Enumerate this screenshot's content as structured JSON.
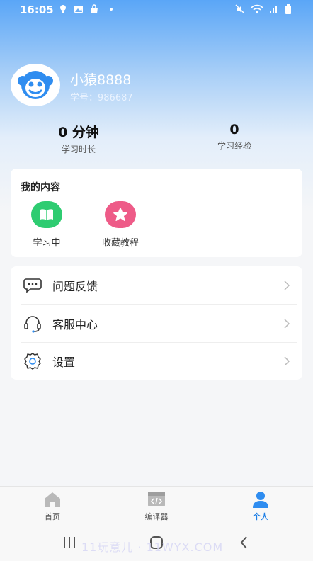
{
  "status_bar": {
    "time": "16:05",
    "left_icons": [
      "bulb-icon",
      "image-icon",
      "bag-icon",
      "dot-icon"
    ],
    "right_icons": [
      "mute-icon",
      "wifi-icon",
      "signal-icon",
      "battery-icon"
    ]
  },
  "profile": {
    "username": "小猿8888",
    "student_id": "学号：986687",
    "avatar": "monkey-avatar-icon"
  },
  "stats": [
    {
      "value": "0 分钟",
      "label": "学习时长"
    },
    {
      "value": "0",
      "label": "学习经验"
    }
  ],
  "my_content": {
    "title": "我的内容",
    "items": [
      {
        "label": "学习中",
        "icon": "book-icon",
        "color": "#2ecc71"
      },
      {
        "label": "收藏教程",
        "icon": "star-icon",
        "color": "#ee5b88"
      }
    ]
  },
  "menu": [
    {
      "label": "问题反馈",
      "icon": "feedback-icon"
    },
    {
      "label": "客服中心",
      "icon": "headset-icon"
    },
    {
      "label": "设置",
      "icon": "gear-icon"
    }
  ],
  "bottom_nav": [
    {
      "label": "首页",
      "icon": "home-icon",
      "active": false
    },
    {
      "label": "编译器",
      "icon": "code-icon",
      "active": false
    },
    {
      "label": "个人",
      "icon": "person-icon",
      "active": true
    }
  ],
  "watermark": "11玩意儿 · 11WYX.COM",
  "colors": {
    "accent": "#3f8ef0",
    "active_tab": "#1e7fe6"
  }
}
